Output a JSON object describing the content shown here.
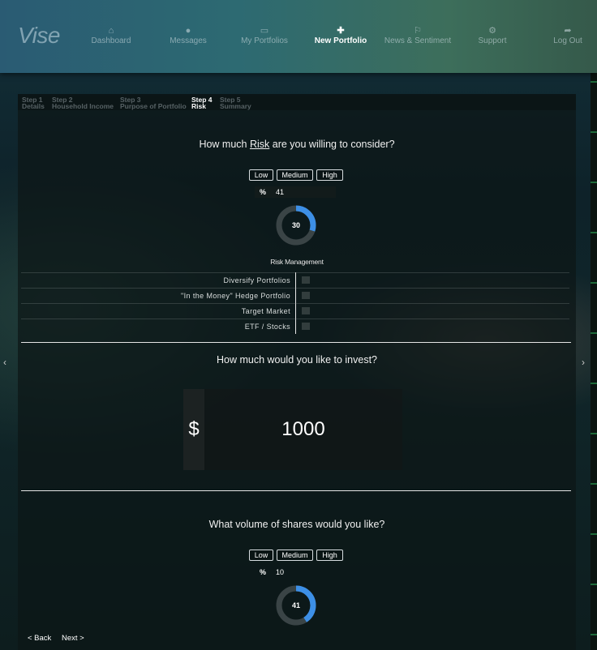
{
  "app": {
    "logo": "Vise"
  },
  "nav": [
    {
      "label": "Dashboard",
      "icon": "home-icon",
      "glyph": "⌂"
    },
    {
      "label": "Messages",
      "icon": "chat-icon",
      "glyph": "●"
    },
    {
      "label": "My Portfolios",
      "icon": "folder-icon",
      "glyph": "▭"
    },
    {
      "label": "New Portfolio",
      "icon": "plus-icon",
      "glyph": "✚"
    },
    {
      "label": "News & Sentiment",
      "icon": "flag-icon",
      "glyph": "⚐"
    },
    {
      "label": "Support",
      "icon": "gears-icon",
      "glyph": "⚙"
    },
    {
      "label": "Log Out",
      "icon": "share-icon",
      "glyph": "➦"
    }
  ],
  "steps": [
    {
      "num": "Step 1",
      "name": "Details"
    },
    {
      "num": "Step 2",
      "name": "Household Income"
    },
    {
      "num": "Step 3",
      "name": "Purpose of Portfolio"
    },
    {
      "num": "Step 4",
      "name": "Risk"
    },
    {
      "num": "Step 5",
      "name": "Summary"
    }
  ],
  "risk": {
    "q_pre": "How much ",
    "q_em": "Risk",
    "q_post": " are you willing to consider?",
    "levels": [
      "Low",
      "Medium",
      "High"
    ],
    "pct_label": "%",
    "pct_value": "41",
    "donut_label": "30",
    "donut_fraction": 0.3
  },
  "risk_management": {
    "title": "Risk Management",
    "items": [
      "Diversify Portfolios",
      "\"In the Money\" Hedge Portfolio",
      "Target Market",
      "ETF / Stocks"
    ]
  },
  "invest": {
    "question": "How much would you like to invest?",
    "currency": "$",
    "amount": "1000"
  },
  "volume": {
    "question": "What volume of shares would you like?",
    "levels": [
      "Low",
      "Medium",
      "High"
    ],
    "pct_label": "%",
    "pct_value": "10",
    "donut_label": "41",
    "donut_fraction": 0.41
  },
  "footer": {
    "back": "< Back",
    "next": "Next >"
  },
  "carousel": {
    "prev": "‹",
    "next": "›"
  },
  "colors": {
    "accent": "#3d8fe6",
    "track": "#3a4446"
  }
}
